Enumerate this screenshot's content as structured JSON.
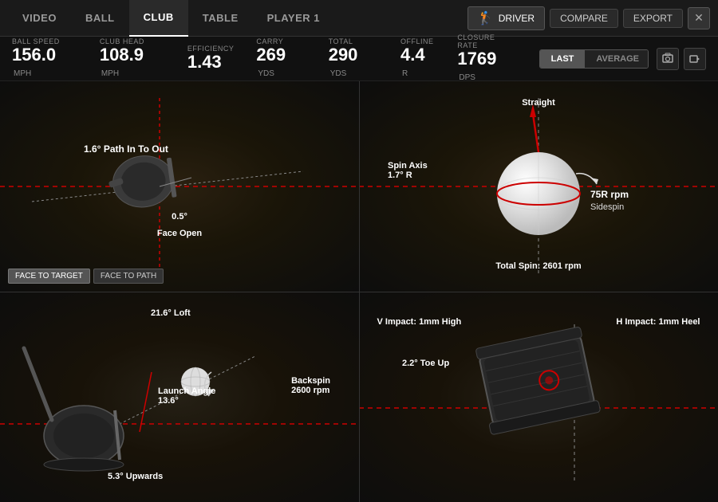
{
  "nav": {
    "items": [
      {
        "label": "VIDEO",
        "active": false
      },
      {
        "label": "BALL",
        "active": false
      },
      {
        "label": "CLUB",
        "active": true
      },
      {
        "label": "TABLE",
        "active": false
      },
      {
        "label": "PLAYER 1",
        "active": false
      }
    ],
    "driver_label": "DRIVER",
    "compare_label": "COMPARE",
    "export_label": "EXPORT",
    "close_label": "✕"
  },
  "stats": {
    "ball_speed": {
      "label": "BALL SPEED",
      "value": "156.0",
      "unit": "MPH"
    },
    "club_head": {
      "label": "CLUB HEAD",
      "value": "108.9",
      "unit": "MPH"
    },
    "efficiency": {
      "label": "EFFICIENCY",
      "value": "1.43",
      "unit": ""
    },
    "carry": {
      "label": "CARRY",
      "value": "269",
      "unit": "YDS"
    },
    "total": {
      "label": "TOTAL",
      "value": "290",
      "unit": "YDS"
    },
    "offline": {
      "label": "OFFLINE",
      "value": "4.4",
      "unit": "R"
    },
    "closure_rate": {
      "label": "CLOSURE RATE",
      "value": "1769",
      "unit": "DPS"
    },
    "toggle_last": "LAST",
    "toggle_avg": "AVERAGE"
  },
  "quadrants": {
    "q1": {
      "path_label": "1.6° Path In To Out",
      "face_label": "0.5°",
      "face_sub": "Face Open",
      "face_to_target": "FACE TO TARGET",
      "face_to_path": "FACE TO PATH"
    },
    "q2": {
      "spin_label": "75R rpm",
      "spin_sub": "Sidespin",
      "spin_axis_label": "Spin Axis",
      "spin_axis_value": "1.7° R",
      "straight_label": "Straight",
      "total_spin_label": "Total Spin: 2601 rpm"
    },
    "q3": {
      "loft_label": "21.6° Loft",
      "launch_label": "Launch Angle",
      "launch_value": "13.6°",
      "backspin_label": "Backspin",
      "backspin_value": "2600 rpm",
      "upwards_label": "5.3° Upwards"
    },
    "q4": {
      "v_impact_label": "V Impact: 1mm High",
      "h_impact_label": "H Impact: 1mm Heel",
      "toe_up_label": "2.2° Toe Up"
    }
  }
}
